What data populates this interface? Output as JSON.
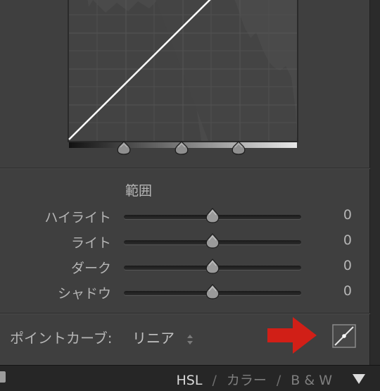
{
  "range_section": {
    "title": "範囲"
  },
  "sliders": [
    {
      "label": "ハイライト",
      "value": "0"
    },
    {
      "label": "ライト",
      "value": "0"
    },
    {
      "label": "ダーク",
      "value": "0"
    },
    {
      "label": "シャドウ",
      "value": "0"
    }
  ],
  "point_curve": {
    "label": "ポイントカーブ:",
    "value": "リニア",
    "button_icon": "linear-curve-icon"
  },
  "annotation": {
    "arrow_color": "#d11f17"
  },
  "bottom_tabs": {
    "hsl": "HSL",
    "separator": "/",
    "color": "カラー",
    "bw": "B & W"
  },
  "colors": {
    "panel_bg": "#3f3f3f",
    "graph_bg": "#4a4a4a",
    "bottom_bar_bg": "#262626"
  }
}
